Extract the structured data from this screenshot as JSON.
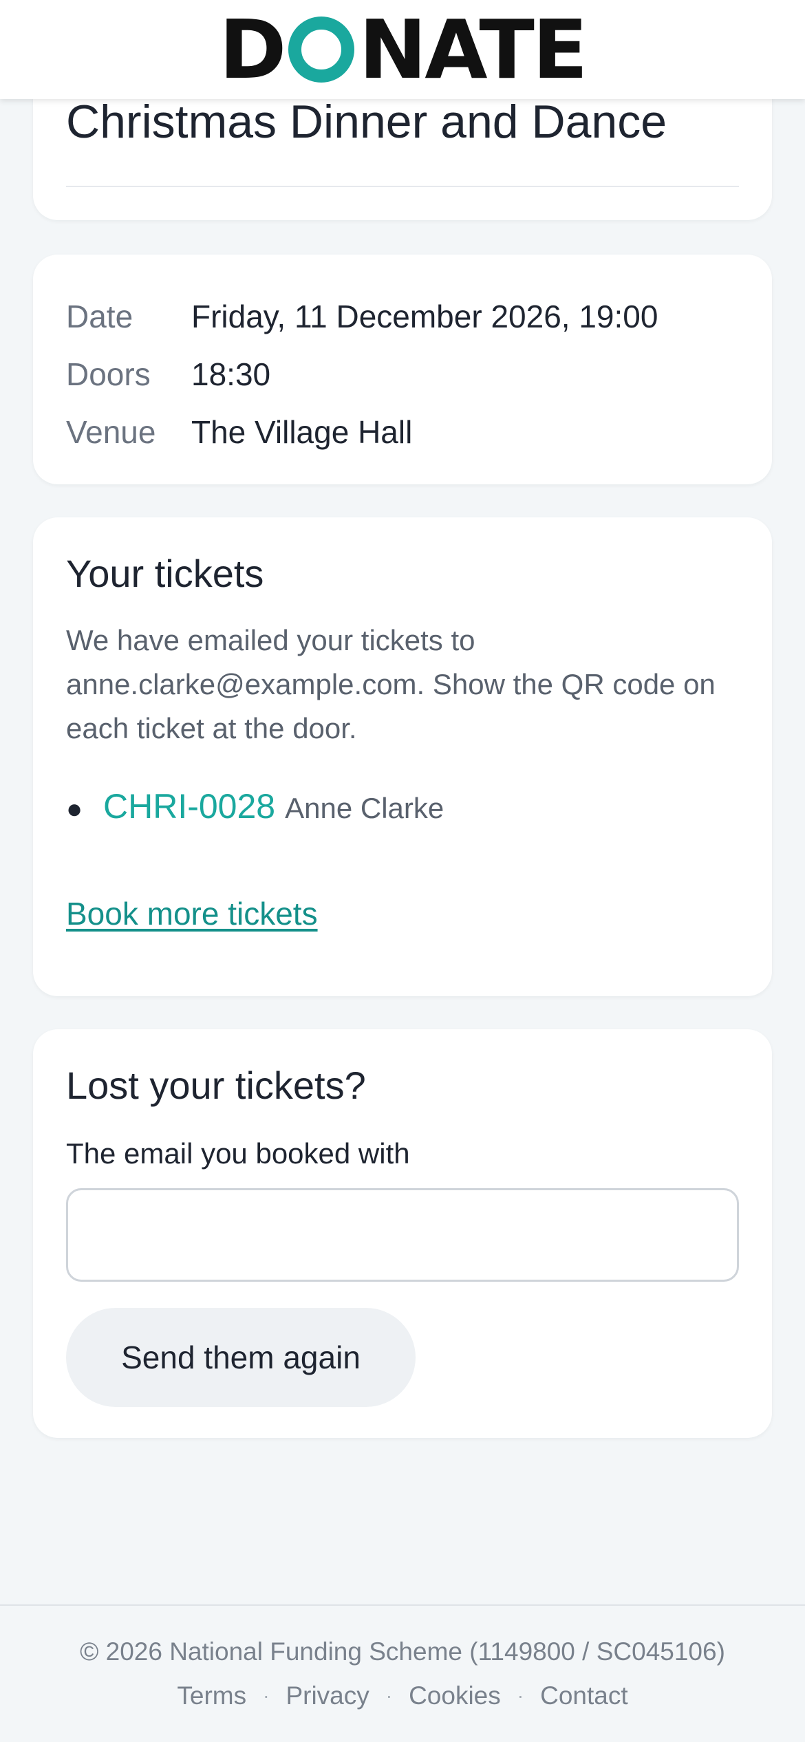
{
  "brand": {
    "logo_before": "D",
    "logo_after": "NATE",
    "accent_color": "#1aa89e"
  },
  "event": {
    "title": "Christmas Dinner and Dance"
  },
  "details": [
    {
      "label": "Date",
      "value": "Friday, 11 December 2026, 19:00"
    },
    {
      "label": "Doors",
      "value": "18:30"
    },
    {
      "label": "Venue",
      "value": "The Village Hall"
    }
  ],
  "tickets": {
    "heading": "Your tickets",
    "intro": "We have emailed your tickets to anne.clarke@example.com. Show the QR code on each ticket at the door.",
    "items": [
      {
        "code": "CHRI-0028",
        "name": "Anne Clarke"
      }
    ],
    "book_more_label": "Book more tickets"
  },
  "lost": {
    "heading": "Lost your tickets?",
    "email_label": "The email you booked with",
    "email_value": "",
    "email_placeholder": "",
    "button_label": "Send them again"
  },
  "footer": {
    "copyright": "© 2026 National Funding Scheme (1149800 / SC045106)",
    "links": [
      "Terms",
      "Privacy",
      "Cookies",
      "Contact"
    ],
    "separator": "·"
  }
}
